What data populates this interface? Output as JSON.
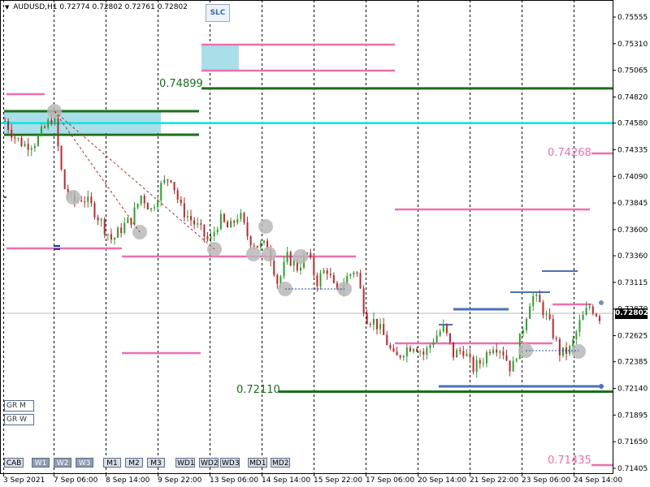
{
  "header": {
    "symbol_tf": "AUDUSD,H1",
    "open": "0.72774",
    "high": "0.72802",
    "low": "0.72761",
    "close": "0.72802"
  },
  "slc_label": "SLC",
  "price_axis": [
    {
      "label": "0.75555",
      "value": 0.75555
    },
    {
      "label": "0.75310",
      "value": 0.7531
    },
    {
      "label": "0.75065",
      "value": 0.75065
    },
    {
      "label": "0.74820",
      "value": 0.7482
    },
    {
      "label": "0.74580",
      "value": 0.7458
    },
    {
      "label": "0.74335",
      "value": 0.74335
    },
    {
      "label": "0.74090",
      "value": 0.7409
    },
    {
      "label": "0.73845",
      "value": 0.73845
    },
    {
      "label": "0.73600",
      "value": 0.736
    },
    {
      "label": "0.73360",
      "value": 0.7336
    },
    {
      "label": "0.73115",
      "value": 0.73115
    },
    {
      "label": "0.72870",
      "value": 0.7287
    },
    {
      "label": "0.72625",
      "value": 0.72625
    },
    {
      "label": "0.72385",
      "value": 0.72385
    },
    {
      "label": "0.72140",
      "value": 0.7214
    },
    {
      "label": "0.71895",
      "value": 0.71895
    },
    {
      "label": "0.71650",
      "value": 0.7165
    },
    {
      "label": "0.71405",
      "value": 0.71405
    }
  ],
  "time_axis": [
    "3 Sep 2021",
    "7 Sep 06:00",
    "8 Sep 14:00",
    "9 Sep 22:00",
    "13 Sep 06:00",
    "14 Sep 14:00",
    "15 Sep 22:00",
    "17 Sep 06:00",
    "20 Sep 14:00",
    "21 Sep 22:00",
    "23 Sep 06:00",
    "24 Sep 14:00"
  ],
  "current_price": "0.72802",
  "level_labels": {
    "green_top": "0.74899",
    "green_bottom": "0.72110",
    "pink_top": "0.74268",
    "pink_bottom": "0.71435"
  },
  "buttons": [
    "CAB",
    "W1",
    "W2",
    "W3",
    "M1",
    "M2",
    "M3",
    "WD1",
    "WD2",
    "WD3",
    "MD1",
    "MD2"
  ],
  "active_buttons": [
    "W1",
    "W2",
    "W3"
  ],
  "gr_buttons": [
    "GR M",
    "GR W"
  ],
  "chart_data": {
    "type": "line",
    "symbol": "AUDUSD",
    "timeframe": "H1",
    "ylim": [
      0.71405,
      0.756
    ],
    "x": [
      "3 Sep 2021",
      "7 Sep 06:00",
      "8 Sep 14:00",
      "9 Sep 22:00",
      "13 Sep 06:00",
      "14 Sep 14:00",
      "15 Sep 22:00",
      "17 Sep 06:00",
      "20 Sep 14:00",
      "21 Sep 22:00",
      "23 Sep 06:00",
      "24 Sep 14:00"
    ],
    "close_path": [
      0.746,
      0.7445,
      0.7438,
      0.744,
      0.7452,
      0.7465,
      0.74,
      0.7385,
      0.739,
      0.738,
      0.7365,
      0.735,
      0.7362,
      0.737,
      0.7392,
      0.7378,
      0.74,
      0.741,
      0.738,
      0.737,
      0.736,
      0.7348,
      0.737,
      0.736,
      0.7375,
      0.7352,
      0.7345,
      0.7345,
      0.731,
      0.7335,
      0.7325,
      0.7338,
      0.7312,
      0.7325,
      0.73,
      0.7315,
      0.7325,
      0.728,
      0.7275,
      0.726,
      0.724,
      0.725,
      0.7255,
      0.7245,
      0.726,
      0.727,
      0.7245,
      0.725,
      0.7232,
      0.724,
      0.7255,
      0.725,
      0.723,
      0.7265,
      0.73,
      0.729,
      0.727,
      0.7245,
      0.725,
      0.7275,
      0.729,
      0.728
    ],
    "levels": [
      {
        "price": 0.74899,
        "color": "#1a6f1a"
      },
      {
        "price": 0.7211,
        "color": "#1a6f1a"
      },
      {
        "price": 0.74268,
        "color": "#ee6fae"
      },
      {
        "price": 0.71435,
        "color": "#ee6fae"
      },
      {
        "price": 0.7458,
        "color": "#00e5e5"
      }
    ]
  },
  "colors": {
    "green_level": "#1a6f1a",
    "pink_level": "#ee6fae",
    "cyan_level": "#00e5e5",
    "blue_level": "#4a72b8",
    "bull_candle": "#2ca02c",
    "bear_candle": "#c0262d"
  },
  "icons": [
    "triangle-down-icon"
  ]
}
